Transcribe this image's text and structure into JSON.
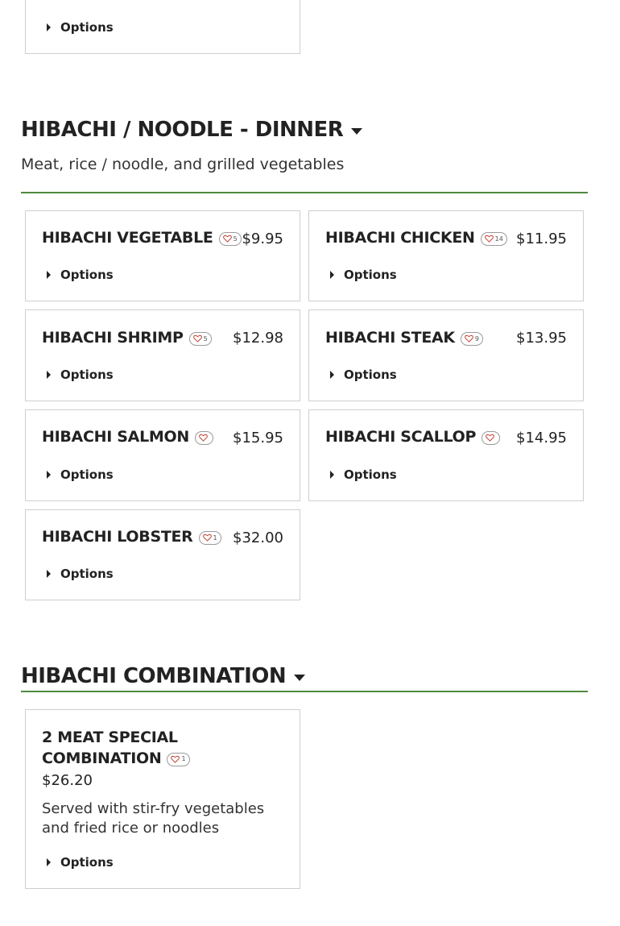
{
  "common": {
    "options_label": "Options"
  },
  "top_card": {
    "options_label": "Options"
  },
  "sections": [
    {
      "title": "HIBACHI / NOODLE - DINNER",
      "description": "Meat, rice / noodle, and grilled vegetables",
      "items": [
        {
          "name": "HIBACHI VEGETABLE",
          "favorites": "5",
          "price": "$9.95",
          "options_label": "Options"
        },
        {
          "name": "HIBACHI CHICKEN",
          "favorites": "14",
          "price": "$11.95",
          "options_label": "Options"
        },
        {
          "name": "HIBACHI SHRIMP",
          "favorites": "5",
          "price": "$12.98",
          "options_label": "Options"
        },
        {
          "name": "HIBACHI STEAK",
          "favorites": "9",
          "price": "$13.95",
          "options_label": "Options"
        },
        {
          "name": "HIBACHI SALMON",
          "favorites": "",
          "price": "$15.95",
          "options_label": "Options"
        },
        {
          "name": "HIBACHI SCALLOP",
          "favorites": "",
          "price": "$14.95",
          "options_label": "Options"
        },
        {
          "name": "HIBACHI LOBSTER",
          "favorites": "1",
          "price": "$32.00",
          "options_label": "Options"
        }
      ]
    },
    {
      "title": "HIBACHI COMBINATION",
      "items": [
        {
          "name_line1": "2 MEAT SPECIAL",
          "name_line2": "COMBINATION",
          "favorites": "1",
          "price": "$26.20",
          "description": "Served with stir-fry vegetables and fried rice or noodles",
          "options_label": "Options"
        }
      ]
    }
  ],
  "colors": {
    "accent": "#4e8a3e",
    "heart": "#c0392b",
    "border": "#cfcfcf"
  },
  "icons": {
    "favorite": "heart-outline-icon",
    "expand": "caret-right-icon",
    "collapse": "caret-down-icon"
  }
}
